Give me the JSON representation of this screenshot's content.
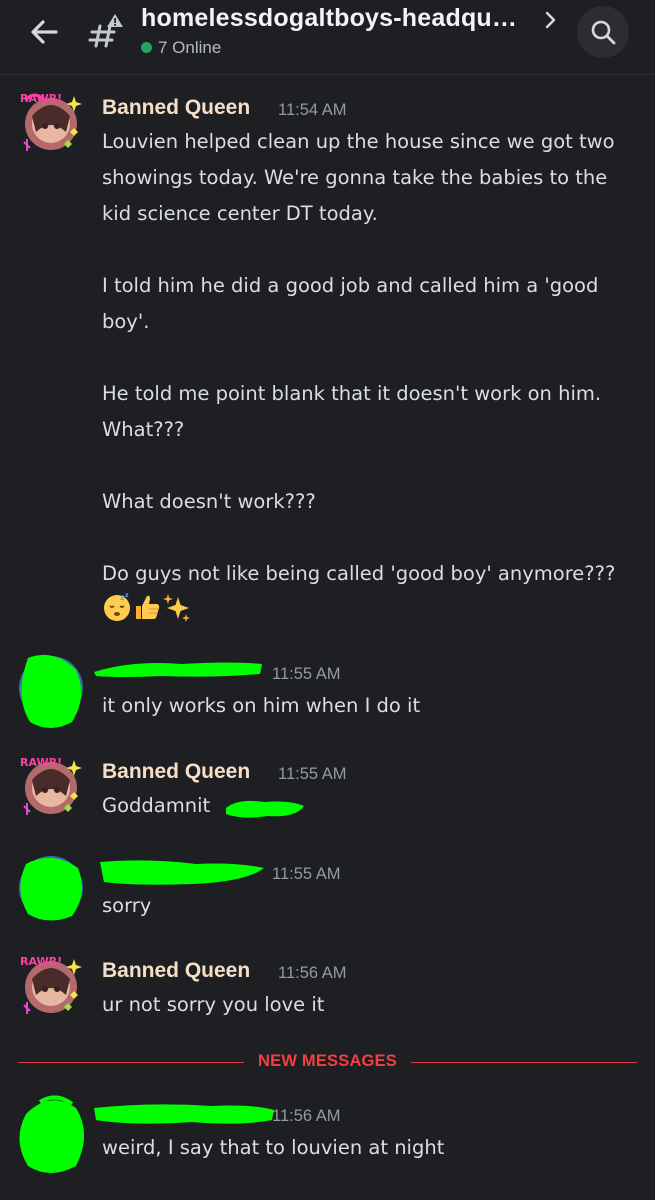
{
  "header": {
    "channel_name": "homelessdogaltboys-headqu…",
    "online_count": "7 Online"
  },
  "messages": [
    {
      "author": "Banned Queen",
      "time": "11:54 AM",
      "text": "Louvien helped clean up the house since we got two showings today. We're gonna take the babies to the kid science center DT today.\n\nI told him he did a good job and called him a 'good boy'.\n\nHe told me point blank that it doesn't work on him. What???\n\nWhat doesn't work???\n\nDo guys not like being called 'good boy' anymore???",
      "emojis": [
        "sleeping-face",
        "thumbs-up",
        "sparkles"
      ]
    },
    {
      "author": "",
      "time": "11:55 AM",
      "text": "it only works on him when I do it"
    },
    {
      "author": "Banned Queen",
      "time": "11:55 AM",
      "text": "Goddamnit"
    },
    {
      "author": "",
      "time": "11:55 AM",
      "text": "sorry"
    },
    {
      "author": "Banned Queen",
      "time": "11:56 AM",
      "text": "ur not sorry you love it"
    },
    {
      "author": "",
      "time": "11:56 AM",
      "text": "weird, I say that to louvien at night"
    }
  ],
  "divider": {
    "label": "NEW MESSAGES"
  },
  "colors": {
    "background": "#1e1f22",
    "accent_red": "#f23f43",
    "online_green": "#23a55a",
    "redaction_green": "#00ff00",
    "author_color": "#f6dfc6"
  },
  "icons": [
    "back-arrow-icon",
    "channel-hash-icon",
    "chevron-right-icon",
    "search-icon"
  ]
}
